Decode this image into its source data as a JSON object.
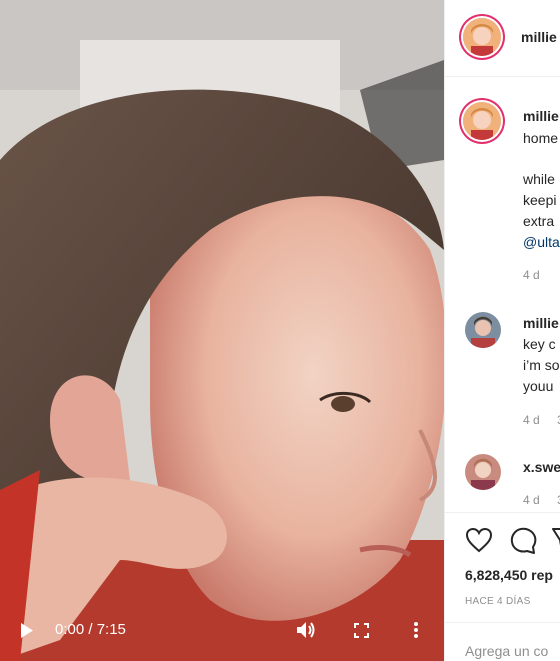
{
  "video": {
    "time": "0:00 / 7:15",
    "icons": [
      "play-icon",
      "volume-icon",
      "fullscreen-icon",
      "more-options-icon"
    ]
  },
  "header": {
    "username": "millie"
  },
  "caption": {
    "username": "millie",
    "line1": "home",
    "lines": [
      "while",
      "keepi",
      "extra"
    ],
    "mention": "@ulta",
    "time": "4 d"
  },
  "comments": [
    {
      "username": "millie",
      "lines": [
        "key c",
        "i’m so",
        "youu"
      ],
      "time": "4 d",
      "extra": "3"
    },
    {
      "username": "x.swe",
      "lines": [],
      "time": "4 d",
      "extra": "3"
    }
  ],
  "actions": {
    "icons": [
      "heart-icon",
      "comment-icon",
      "share-icon"
    ]
  },
  "likes": "6,828,450 rep",
  "posted_ago": "HACE 4 DÍAS",
  "comment_input": {
    "placeholder": "Agrega un co"
  },
  "colors": {
    "ring": "#e1306c",
    "link": "#00376b",
    "muted": "#8e8e8e"
  }
}
